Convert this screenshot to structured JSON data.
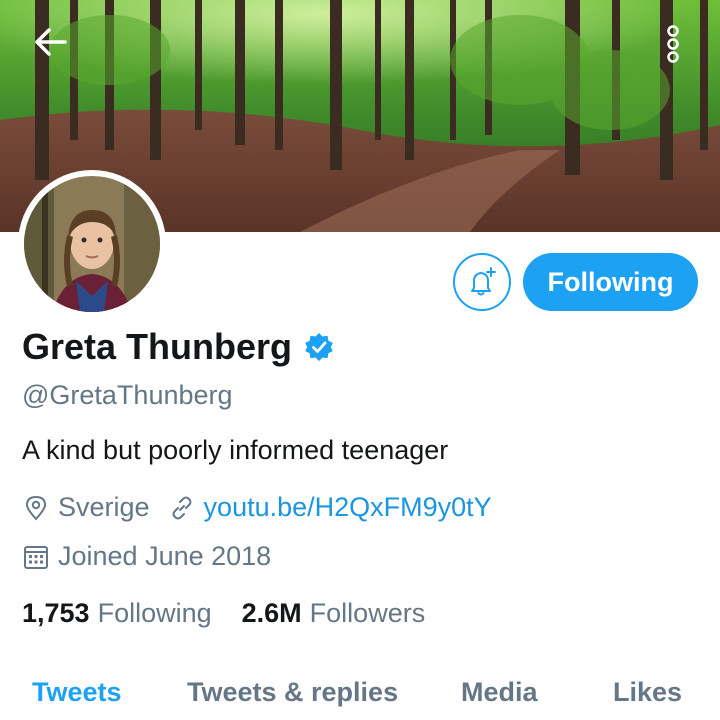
{
  "header": {
    "back_icon": "arrow-left-icon",
    "more_icon": "more-vertical-icon"
  },
  "profile": {
    "name": "Greta Thunberg",
    "verified": true,
    "handle": "@GretaThunberg",
    "bio": "A kind but poorly informed teenager",
    "location": "Sverige",
    "website": "youtu.be/H2QxFM9y0tY",
    "joined": "Joined June 2018"
  },
  "actions": {
    "notify_icon": "bell-plus-icon",
    "follow_label": "Following"
  },
  "stats": {
    "following_count": "1,753",
    "following_label": "Following",
    "followers_count": "2.6M",
    "followers_label": "Followers"
  },
  "tabs": [
    {
      "label": "Tweets",
      "active": true
    },
    {
      "label": "Tweets & replies",
      "active": false
    },
    {
      "label": "Media",
      "active": false
    },
    {
      "label": "Likes",
      "active": false
    }
  ],
  "colors": {
    "accent": "#1da1f2",
    "link": "#1b95e0",
    "text": "#14171a",
    "muted": "#657786"
  }
}
